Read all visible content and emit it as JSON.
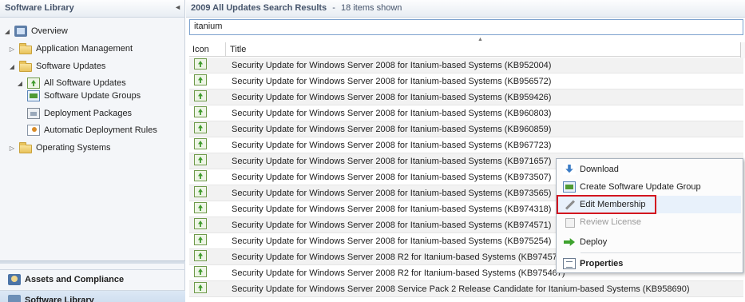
{
  "nav": {
    "header": "Software Library",
    "collapse_glyph": "◄",
    "tree": [
      {
        "label": "Overview",
        "icon": "overview-icon",
        "expander": "◢"
      },
      {
        "label": "Application Management",
        "icon": "folder-icon",
        "expander": "▷"
      },
      {
        "label": "Software Updates",
        "icon": "folder-icon",
        "expander": "◢"
      },
      {
        "label": "All Software Updates",
        "icon": "software-updates-icon",
        "expander": "◢"
      },
      {
        "label": "Software Update Groups",
        "icon": "update-group-icon",
        "expander": ""
      },
      {
        "label": "Deployment Packages",
        "icon": "deployment-package-icon",
        "expander": ""
      },
      {
        "label": "Automatic Deployment Rules",
        "icon": "deployment-rule-icon",
        "expander": ""
      },
      {
        "label": "Operating Systems",
        "icon": "folder-icon",
        "expander": "▷"
      }
    ],
    "workspaces": [
      {
        "label": "Assets and Compliance",
        "icon": "assets-compliance-icon"
      },
      {
        "label": "Software Library",
        "icon": "software-library-icon"
      }
    ]
  },
  "results": {
    "title": "2009 All Updates Search Results",
    "separator": "-",
    "count": "18 items shown",
    "search_value": "itanium",
    "sort_glyph": "▲",
    "columns": {
      "icon": "Icon",
      "title": "Title"
    },
    "rows": [
      "Security Update for Windows Server 2008 for Itanium-based Systems (KB952004)",
      "Security Update for Windows Server 2008 for Itanium-based Systems (KB956572)",
      "Security Update for Windows Server 2008 for Itanium-based Systems (KB959426)",
      "Security Update for Windows Server 2008 for Itanium-based Systems (KB960803)",
      "Security Update for Windows Server 2008 for Itanium-based Systems (KB960859)",
      "Security Update for Windows Server 2008 for Itanium-based Systems (KB967723)",
      "Security Update for Windows Server 2008 for Itanium-based Systems (KB971657)",
      "Security Update for Windows Server 2008 for Itanium-based Systems (KB973507)",
      "Security Update for Windows Server 2008 for Itanium-based Systems (KB973565)",
      "Security Update for Windows Server 2008 for Itanium-based Systems (KB974318)",
      "Security Update for Windows Server 2008 for Itanium-based Systems (KB974571)",
      "Security Update for Windows Server 2008 for Itanium-based Systems (KB975254)",
      "Security Update for Windows Server 2008 R2 for Itanium-based Systems (KB974571)",
      "Security Update for Windows Server 2008 R2 for Itanium-based Systems (KB975467)",
      "Security Update for Windows Server 2008 Service Pack 2 Release Candidate for Itanium-based Systems (KB958690)"
    ]
  },
  "context_menu": {
    "items": [
      {
        "label": "Download",
        "icon": "download-icon",
        "state": "enabled"
      },
      {
        "label": "Create Software Update Group",
        "icon": "create-group-icon",
        "state": "enabled"
      },
      {
        "label": "Edit Membership",
        "icon": "edit-icon",
        "state": "highlighted"
      },
      {
        "label": "Review License",
        "icon": "review-license-icon",
        "state": "disabled"
      },
      {
        "label": "Deploy",
        "icon": "deploy-icon",
        "state": "enabled"
      },
      {
        "label": "Properties",
        "icon": "properties-icon",
        "state": "bold"
      }
    ],
    "highlight_color": "#d3141f"
  }
}
